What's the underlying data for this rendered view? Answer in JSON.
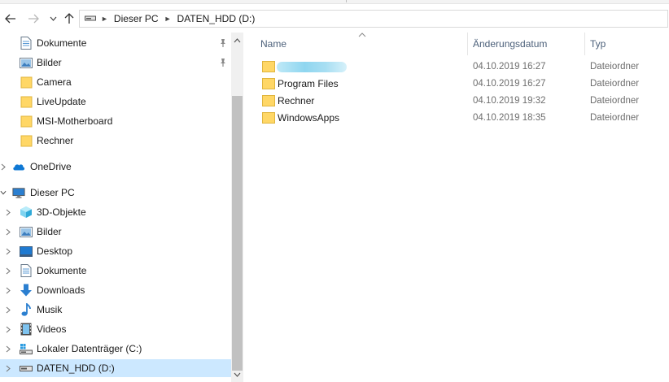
{
  "navigation": {
    "back_icon": "back-arrow-icon",
    "forward_icon": "forward-arrow-icon",
    "recent_icon": "chevron-down-icon",
    "up_icon": "up-arrow-icon"
  },
  "address": {
    "drive_icon": "drive-icon",
    "segments": [
      "Dieser PC",
      "DATEN_HDD (D:)"
    ]
  },
  "sidebar": {
    "quick_access": [
      {
        "label": "Dokumente",
        "icon": "documents-icon",
        "pinned": true
      },
      {
        "label": "Bilder",
        "icon": "pictures-icon",
        "pinned": true
      },
      {
        "label": "Camera",
        "icon": "folder-icon",
        "pinned": false
      },
      {
        "label": "LiveUpdate",
        "icon": "folder-icon",
        "pinned": false
      },
      {
        "label": "MSI-Motherboard",
        "icon": "folder-icon",
        "pinned": false
      },
      {
        "label": "Rechner",
        "icon": "folder-icon",
        "pinned": false
      }
    ],
    "onedrive": {
      "label": "OneDrive",
      "icon": "cloud-icon"
    },
    "this_pc": {
      "label": "Dieser PC",
      "icon": "monitor-icon"
    },
    "this_pc_children": [
      {
        "label": "3D-Objekte",
        "icon": "cube-icon"
      },
      {
        "label": "Bilder",
        "icon": "pictures-icon"
      },
      {
        "label": "Desktop",
        "icon": "desktop-icon"
      },
      {
        "label": "Dokumente",
        "icon": "documents-icon"
      },
      {
        "label": "Downloads",
        "icon": "download-icon"
      },
      {
        "label": "Musik",
        "icon": "music-note-icon"
      },
      {
        "label": "Videos",
        "icon": "film-icon"
      },
      {
        "label": "Lokaler Datenträger (C:)",
        "icon": "system-drive-icon"
      },
      {
        "label": "DATEN_HDD (D:)",
        "icon": "drive-icon",
        "selected": true
      }
    ]
  },
  "filelist": {
    "columns": {
      "name": "Name",
      "date": "Änderungsdatum",
      "type": "Typ"
    },
    "rows": [
      {
        "name": "",
        "date": "04.10.2019 16:27",
        "type": "Dateiordner",
        "redacted": true
      },
      {
        "name": "Program Files",
        "date": "04.10.2019 16:27",
        "type": "Dateiordner"
      },
      {
        "name": "Rechner",
        "date": "04.10.2019 19:32",
        "type": "Dateiordner"
      },
      {
        "name": "WindowsApps",
        "date": "04.10.2019 18:35",
        "type": "Dateiordner"
      }
    ]
  },
  "colors": {
    "selection": "#cce8ff",
    "folder": "#ffd766",
    "header_text": "#4c607a",
    "meta_text": "#6d6d6d"
  }
}
